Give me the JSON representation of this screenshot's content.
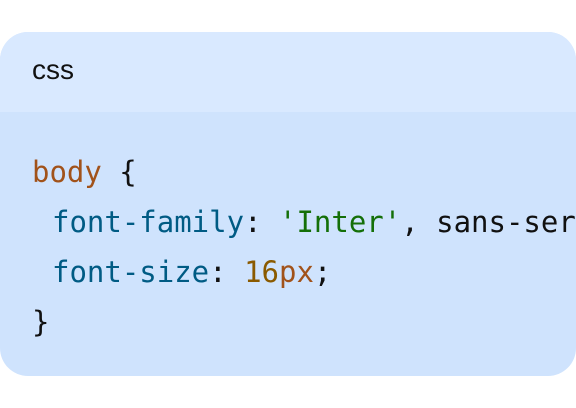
{
  "code_block": {
    "language": "css",
    "lines": {
      "line1": {
        "selector": "body",
        "open_brace": " {"
      },
      "line2": {
        "property": "font-family",
        "colon": ": ",
        "string": "'Inter'",
        "rest": ", sans-serif;"
      },
      "line3": {
        "property": "font-size",
        "colon": ": ",
        "number": "16",
        "unit": "px",
        "semicolon": ";"
      },
      "line4": {
        "close_brace": "}"
      }
    }
  }
}
